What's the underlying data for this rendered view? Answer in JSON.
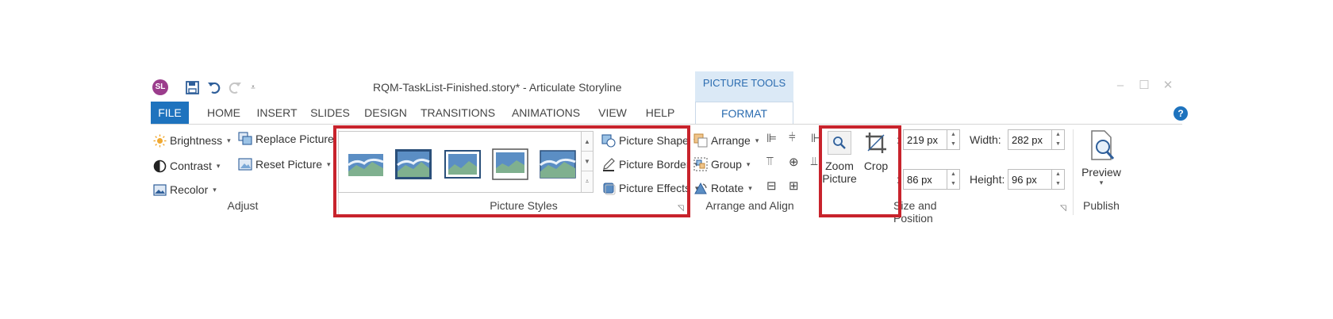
{
  "app": {
    "logo_text": "SL",
    "title": "RQM-TaskList-Finished.story* -  Articulate Storyline",
    "context_tab": "PICTURE TOOLS"
  },
  "tabs": [
    "FILE",
    "HOME",
    "INSERT",
    "SLIDES",
    "DESIGN",
    "TRANSITIONS",
    "ANIMATIONS",
    "VIEW",
    "HELP",
    "FORMAT"
  ],
  "help_symbol": "?",
  "adjust": {
    "brightness": "Brightness",
    "contrast": "Contrast",
    "recolor": "Recolor",
    "replace_picture": "Replace Picture",
    "reset_picture": "Reset Picture",
    "label": "Adjust"
  },
  "picture_styles": {
    "shape": "Picture Shape",
    "border": "Picture Border",
    "effects": "Picture Effects",
    "label": "Picture Styles"
  },
  "arrange": {
    "arrange": "Arrange",
    "group": "Group",
    "rotate": "Rotate",
    "label": "Arrange and Align"
  },
  "zoom_crop": {
    "zoom_line1": "Zoom",
    "zoom_line2": "Picture",
    "crop": "Crop"
  },
  "size_position": {
    "x_label": ":",
    "x_value": "219 px",
    "y_label": ":",
    "y_value": "86 px",
    "width_label": "Width:",
    "width_value": "282 px",
    "height_label": "Height:",
    "height_value": "96 px",
    "label": "Size and Position"
  },
  "publish": {
    "preview": "Preview",
    "label": "Publish"
  },
  "colors": {
    "accent": "#1e73be",
    "context_tab_bg": "#dbe9f6",
    "highlight": "#c8232c"
  }
}
